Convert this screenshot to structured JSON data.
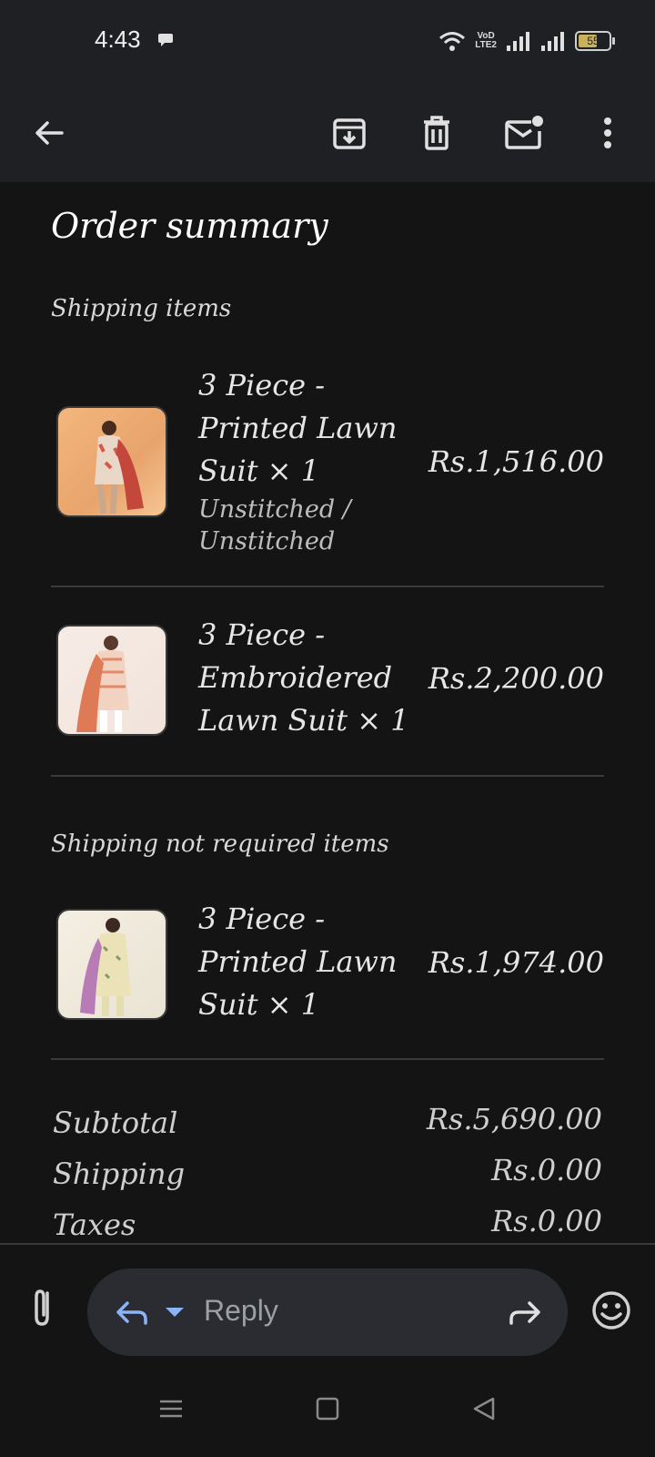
{
  "status_bar": {
    "time": "4:43",
    "network_label_top": "VoD",
    "network_label_bottom": "LTE2",
    "battery": "55"
  },
  "toolbar": {
    "icons": [
      "back-arrow-icon",
      "archive-icon",
      "trash-icon",
      "mark-unread-icon",
      "more-vert-icon"
    ]
  },
  "email": {
    "title": "Order summary",
    "sections": [
      {
        "label": "Shipping items",
        "items": [
          {
            "name": "3 Piece - Printed Lawn Suit × 1",
            "variant": "Unstitched / Unstitched",
            "price": "Rs.1,516.00"
          },
          {
            "name": "3 Piece - Embroidered Lawn Suit × 1",
            "variant": "",
            "price": "Rs.2,200.00"
          }
        ]
      },
      {
        "label": "Shipping not required items",
        "items": [
          {
            "name": "3 Piece - Printed Lawn Suit × 1",
            "variant": "",
            "price": "Rs.1,974.00"
          }
        ]
      }
    ],
    "summary": [
      {
        "label": "Subtotal",
        "value": "Rs.5,690.00"
      },
      {
        "label": "Shipping",
        "value": "Rs.0.00"
      },
      {
        "label": "Taxes",
        "value": "Rs.0.00"
      }
    ]
  },
  "reply_bar": {
    "placeholder": "Reply"
  },
  "colors": {
    "accent": "#8ab4f8",
    "background": "#141414",
    "toolbar": "#1f2024",
    "pill": "#2a2c31"
  }
}
